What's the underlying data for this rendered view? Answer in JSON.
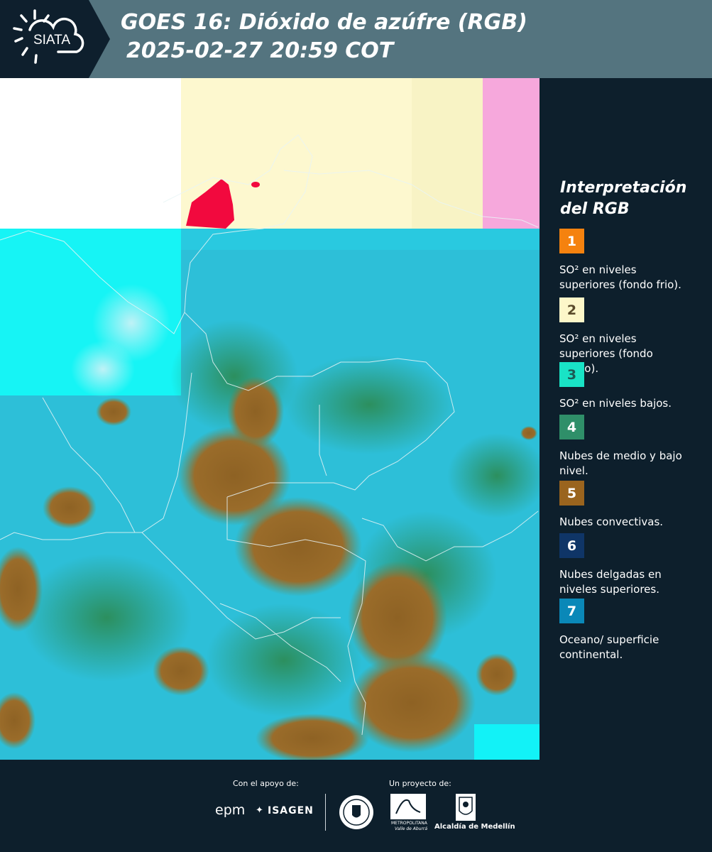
{
  "header": {
    "logo_text": "SIATA",
    "title_line1": "GOES 16: Dióxido de azúfre (RGB)",
    "title_line2": "2025-02-27 20:59 COT",
    "background_color": "#54747f"
  },
  "map": {
    "description_icon": "satellite-rgb-map"
  },
  "legend": {
    "title_line1": "Interpretación",
    "title_line2": "del RGB",
    "items": [
      {
        "number": "1",
        "label": "SO² en niveles superiores (fondo frio).",
        "color": "#f5820f",
        "text_color": "#ffffff"
      },
      {
        "number": "2",
        "label": "SO² en niveles superiores (fondo calido).",
        "color": "#fdf7c9",
        "text_color": "#5a4a2a"
      },
      {
        "number": "3",
        "label": "SO² en niveles bajos.",
        "color": "#19e3c6",
        "text_color": "#1d5a55"
      },
      {
        "number": "4",
        "label": "Nubes de medio y bajo nivel.",
        "color": "#2f8f69",
        "text_color": "#ffffff"
      },
      {
        "number": "5",
        "label": "Nubes convectivas.",
        "color": "#9a641e",
        "text_color": "#ffffff"
      },
      {
        "number": "6",
        "label": "Nubes delgadas en niveles superiores.",
        "color": "#0f3567",
        "text_color": "#ffffff"
      },
      {
        "number": "7",
        "label": "Oceano/ superficie continental.",
        "color": "#0a88b8",
        "text_color": "#ffffff"
      }
    ]
  },
  "footer": {
    "support_label": "Con el apoyo de:",
    "project_label": "Un proyecto de:",
    "epm": "epm",
    "isagen": "ISAGEN",
    "area_metro_line1": "METROPOLITANA",
    "area_metro_line2": "Valle de Aburrá",
    "alcaldia": "Alcaldía de Medellín"
  }
}
